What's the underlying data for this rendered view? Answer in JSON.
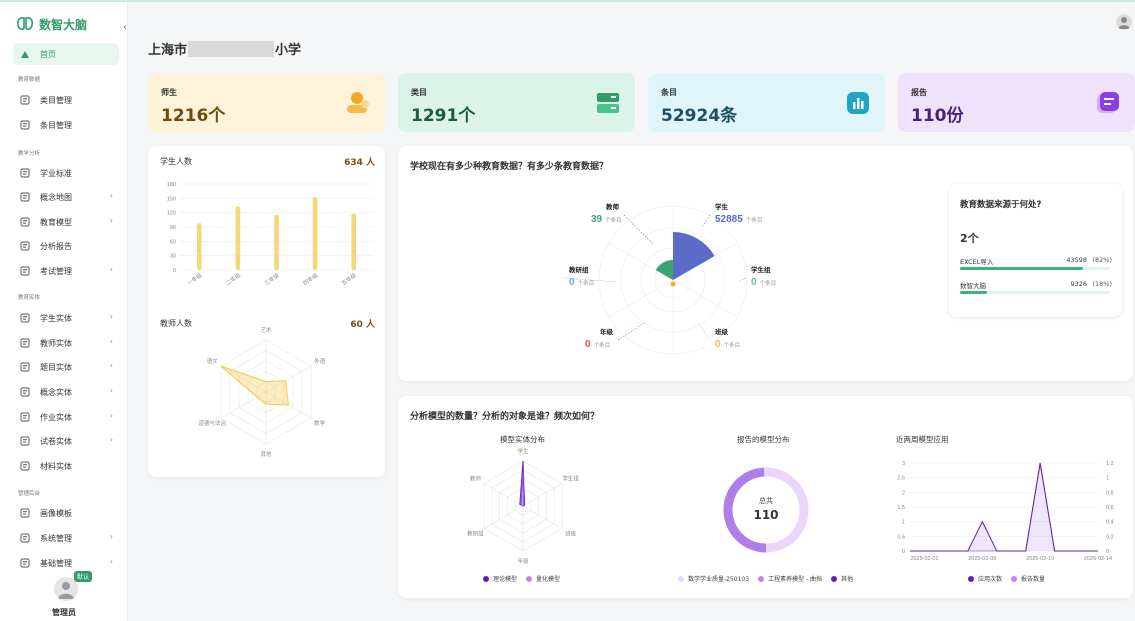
{
  "app": {
    "name": "数智大脑",
    "collapse": "‹"
  },
  "sidebar": {
    "home": "首页",
    "sections": [
      "教育数据",
      "教学分析",
      "教育实体",
      "管理后台"
    ],
    "items": [
      {
        "label": "类目管理",
        "chev": false
      },
      {
        "label": "条目管理",
        "chev": false
      },
      {
        "label": "学业标准",
        "chev": false
      },
      {
        "label": "概念地图",
        "chev": true
      },
      {
        "label": "教育模型",
        "chev": true
      },
      {
        "label": "分析报告",
        "chev": false
      },
      {
        "label": "考试管理",
        "chev": true
      },
      {
        "label": "学生实体",
        "chev": true
      },
      {
        "label": "教师实体",
        "chev": true
      },
      {
        "label": "题目实体",
        "chev": true
      },
      {
        "label": "概念实体",
        "chev": true
      },
      {
        "label": "作业实体",
        "chev": true
      },
      {
        "label": "试卷实体",
        "chev": true
      },
      {
        "label": "材料实体",
        "chev": false
      },
      {
        "label": "画像模板",
        "chev": false
      },
      {
        "label": "系统管理",
        "chev": true
      },
      {
        "label": "基础管理",
        "chev": true
      }
    ],
    "user_badge": "默认",
    "user_name": "管理员"
  },
  "page": {
    "title_prefix": "上海市",
    "title_suffix": "小学"
  },
  "stats": [
    {
      "label": "师生",
      "value": "1216个",
      "bg": "#fdf3d9",
      "color": "#6b4a0f"
    },
    {
      "label": "类目",
      "value": "1291个",
      "bg": "#dcf3ea",
      "color": "#1e5b45"
    },
    {
      "label": "条目",
      "value": "52924条",
      "bg": "#dff5f9",
      "color": "#1f4f63"
    },
    {
      "label": "报告",
      "value": "110份",
      "bg": "#efe2fb",
      "color": "#4a2275"
    }
  ],
  "students": {
    "title": "学生人数",
    "count": "634 人"
  },
  "teachers": {
    "title": "教师人数",
    "count": "60 人"
  },
  "edu": {
    "title": "学校现在有多少种教育数据？有多少条教育数据？",
    "unit": "个条目",
    "nodes": [
      {
        "name": "教师",
        "value": "39",
        "color": "#3da274"
      },
      {
        "name": "学生",
        "value": "52885",
        "color": "#5a6cc8"
      },
      {
        "name": "学生组",
        "value": "0",
        "color": "#6abf8c"
      },
      {
        "name": "班级",
        "value": "0",
        "color": "#f0c14a"
      },
      {
        "name": "年级",
        "value": "0",
        "color": "#e05555"
      },
      {
        "name": "教研组",
        "value": "0",
        "color": "#6fb3d8"
      }
    ],
    "source": {
      "title": "教育数据来源于何处?",
      "count": "2个",
      "rows": [
        {
          "name": "EXCEL导入",
          "value": "43598",
          "pct": "(82%)",
          "fill": 0.82
        },
        {
          "name": "数智大脑",
          "value": "9326",
          "pct": "(18%)",
          "fill": 0.18
        }
      ]
    }
  },
  "model": {
    "title": "分析模型的数量？分析的对象是谁？频次如何？",
    "radar_title": "模型实体分布",
    "donut_title": "报告的模型分布",
    "donut_center_label": "总共",
    "donut_center_value": "110",
    "line_title": "近两周模型应用",
    "radar_legend": [
      "理论模型",
      "量化模型"
    ],
    "donut_legend": [
      "数学学业质量-250103",
      "工程素养模型 - 曲挡",
      "其他"
    ],
    "line_legend": [
      "应用次数",
      "报告数量"
    ]
  },
  "chart_data": [
    {
      "type": "bar",
      "title": "学生人数",
      "categories": [
        "一年级",
        "二年级",
        "三年级",
        "四年级",
        "五年级"
      ],
      "values": [
        98,
        133,
        116,
        153,
        118
      ],
      "ylim": [
        0,
        180
      ],
      "yticks": [
        0,
        30,
        60,
        90,
        120,
        150,
        180
      ]
    },
    {
      "type": "radar",
      "title": "教师人数",
      "axes": [
        "艺术",
        "外语",
        "数学",
        "其他",
        "道德与法治",
        "语文"
      ],
      "values": [
        6,
        13,
        15,
        7,
        6,
        30
      ],
      "max": 30
    },
    {
      "type": "pie",
      "title": "学校现在有多少种教育数据？有多少条教育数据？",
      "categories": [
        "学生",
        "教师",
        "学生组",
        "班级",
        "年级",
        "教研组"
      ],
      "values": [
        52885,
        39,
        0,
        0,
        0,
        0
      ]
    },
    {
      "type": "radar",
      "title": "模型实体分布",
      "axes": [
        "学生",
        "学生组",
        "班级",
        "年级",
        "教研组",
        "教师"
      ],
      "series": [
        {
          "name": "理论模型",
          "values": [
            100,
            4,
            0,
            0,
            0,
            8
          ]
        },
        {
          "name": "量化模型",
          "values": [
            75,
            2,
            0,
            0,
            0,
            5
          ]
        }
      ],
      "max": 100
    },
    {
      "type": "pie",
      "title": "报告的模型分布",
      "categories": [
        "数学学业质量-250103",
        "工程素养模型 - 曲挡",
        "其他"
      ],
      "values": [
        108,
        1,
        1
      ]
    },
    {
      "type": "line",
      "title": "近两周模型应用",
      "x": [
        "2025-02-01",
        "2025-02-02",
        "2025-02-03",
        "2025-02-04",
        "2025-02-05",
        "2025-02-06",
        "2025-02-07",
        "2025-02-08",
        "2025-02-09",
        "2025-02-10",
        "2025-02-11",
        "2025-02-12",
        "2025-02-13",
        "2025-02-14"
      ],
      "xticks": [
        "2025-02-02",
        "2025-02-06",
        "2025-02-10",
        "2025-02-14"
      ],
      "series": [
        {
          "name": "应用次数",
          "values": [
            0,
            0,
            0,
            0,
            0,
            1,
            0,
            0,
            0,
            3,
            0,
            0,
            0,
            0
          ]
        },
        {
          "name": "报告数量",
          "values": [
            0,
            0,
            0,
            0,
            0,
            0,
            0,
            0,
            0,
            1.2,
            0,
            0,
            0,
            0
          ]
        }
      ],
      "ylim": [
        0,
        3
      ],
      "yticks": [
        "0",
        "0.5",
        "1",
        "1.5",
        "2",
        "2.5",
        "3"
      ],
      "y2lim": [
        0,
        1.2
      ],
      "y2ticks": [
        "0",
        "0.2",
        "0.4",
        "0.6",
        "0.8",
        "1",
        "1.2"
      ]
    }
  ],
  "colors": {
    "primary": "#2f9e69",
    "bar": "#f5d77a",
    "radar": "#f3c94c",
    "donut": "#b07ee8",
    "line1": "#5b21b6",
    "line2": "#b98ae8"
  }
}
